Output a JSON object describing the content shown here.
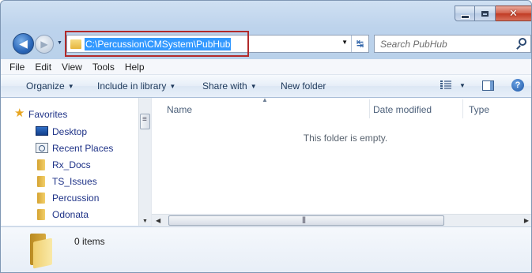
{
  "window": {
    "caption_close": "✕"
  },
  "navigation": {
    "address": "C:\\Percussion\\CMSystem\\PubHub",
    "search_placeholder": "Search PubHub"
  },
  "menu": [
    "File",
    "Edit",
    "View",
    "Tools",
    "Help"
  ],
  "toolbar": {
    "organize": "Organize",
    "include_in_library": "Include in library",
    "share_with": "Share with",
    "new_folder": "New folder"
  },
  "nav_pane": {
    "favorites_label": "Favorites",
    "items": [
      "Desktop",
      "Recent Places",
      "Rx_Docs",
      "TS_Issues",
      "Percussion",
      "Odonata"
    ]
  },
  "content": {
    "columns": [
      "Name",
      "Date modified",
      "Type"
    ],
    "empty_message": "This folder is empty."
  },
  "details": {
    "item_count": "0 items"
  },
  "colors": {
    "highlight_border": "#b22a2a",
    "address_selection": "#3399ff"
  }
}
